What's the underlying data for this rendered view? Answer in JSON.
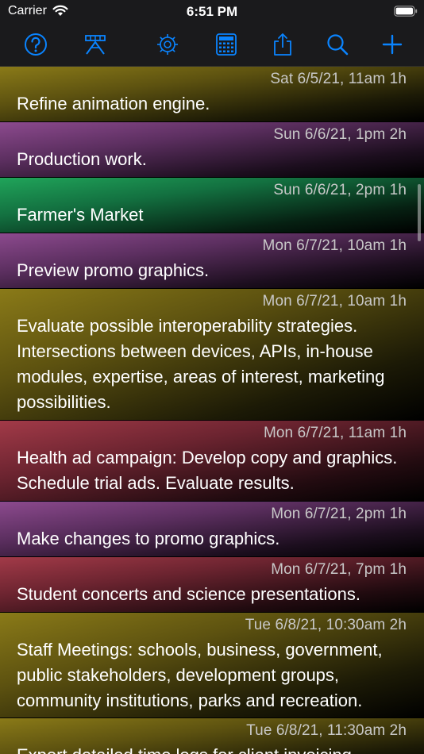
{
  "status_bar": {
    "carrier": "Carrier",
    "time": "6:51 PM",
    "wifi_icon": "wifi-icon",
    "battery_icon": "battery-icon"
  },
  "toolbar": {
    "accent_color": "#0a84ff",
    "buttons": [
      {
        "name": "help-button",
        "icon": "question-circle-icon"
      },
      {
        "name": "gantt-button",
        "icon": "gantt-icon"
      },
      {
        "name": "settings-button",
        "icon": "gear-icon"
      },
      {
        "name": "calendar-button",
        "icon": "calendar-grid-icon"
      },
      {
        "name": "share-button",
        "icon": "share-icon"
      },
      {
        "name": "search-button",
        "icon": "search-icon"
      },
      {
        "name": "add-button",
        "icon": "plus-icon"
      }
    ]
  },
  "colors": {
    "yellow": "#8a7a18",
    "purple": "#8c4a8e",
    "green": "#20a45a",
    "red": "#a23a48"
  },
  "events": [
    {
      "time": "Sat 6/5/21, 11am 1h",
      "text": "Refine animation engine.",
      "color": "yellow"
    },
    {
      "time": "Sun 6/6/21, 1pm 2h",
      "text": "Production work.",
      "color": "purple"
    },
    {
      "time": "Sun 6/6/21, 2pm 1h",
      "text": "Farmer's Market",
      "color": "green"
    },
    {
      "time": "Mon 6/7/21, 10am 1h",
      "text": "Preview promo graphics.",
      "color": "purple"
    },
    {
      "time": "Mon 6/7/21, 10am 1h",
      "text": "Evaluate possible interoperability strategies. Intersections between devices, APIs, in-house modules, expertise, areas of interest, marketing possibilities.",
      "color": "yellow"
    },
    {
      "time": "Mon 6/7/21, 11am 1h",
      "text": "Health ad campaign: Develop copy and graphics. Schedule trial ads. Evaluate results.",
      "color": "red"
    },
    {
      "time": "Mon 6/7/21, 2pm 1h",
      "text": "Make changes to promo graphics.",
      "color": "purple"
    },
    {
      "time": "Mon 6/7/21, 7pm 1h",
      "text": "Student concerts and science presentations.",
      "color": "red"
    },
    {
      "time": "Tue 6/8/21, 10:30am 2h",
      "text": "Staff Meetings: schools, business, government, public stakeholders, development groups, community institutions, parks and recreation.",
      "color": "yellow"
    },
    {
      "time": "Tue 6/8/21, 11:30am 2h",
      "text": "Export detailed time logs for client invoicing.",
      "color": "yellow"
    }
  ]
}
